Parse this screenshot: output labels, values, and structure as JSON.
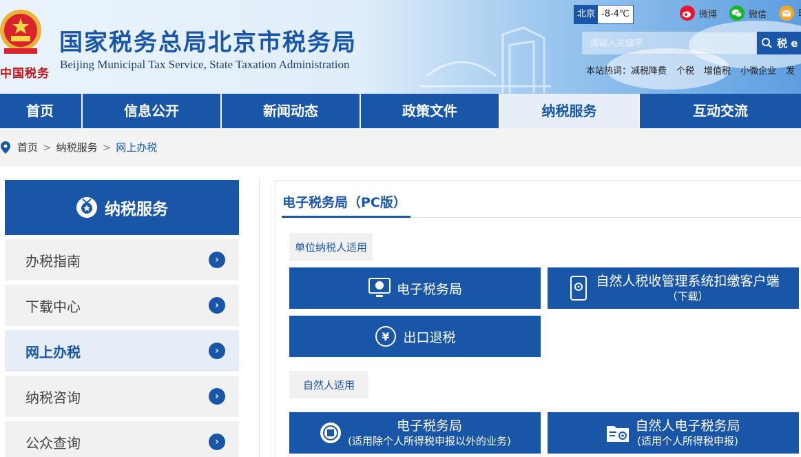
{
  "header": {
    "seal_text": "中国税务",
    "title": "国家税务总局北京市税务局",
    "subtitle": "Beijing Municipal Tax Service, State Taxation Administration",
    "weather_city": "北京",
    "weather_temp": "-8-4℃",
    "weibo_label": "微博",
    "wechat_label": "微信",
    "mail_label": "E",
    "search_placeholder": "请输入关键字",
    "search_button": "税 e",
    "hot_label": "本站热词：",
    "hot_words": [
      "减税降费",
      "个税",
      "增值税",
      "小微企业",
      "发"
    ]
  },
  "nav": {
    "items": [
      {
        "label": "首页"
      },
      {
        "label": "信息公开"
      },
      {
        "label": "新闻动态"
      },
      {
        "label": "政策文件"
      },
      {
        "label": "纳税服务"
      },
      {
        "label": "互动交流"
      }
    ]
  },
  "breadcrumb": {
    "home": "首页",
    "sep": ">",
    "level1": "纳税服务",
    "current": "网上办税"
  },
  "sidebar": {
    "title": "纳税服务",
    "items": [
      {
        "label": "办税指南",
        "arrow": "›"
      },
      {
        "label": "下载中心",
        "arrow": "›"
      },
      {
        "label": "网上办税",
        "arrow": "›"
      },
      {
        "label": "纳税咨询",
        "arrow": "›"
      },
      {
        "label": "公众查询",
        "arrow": "›"
      }
    ]
  },
  "main": {
    "title": "电子税务局（PC版）",
    "section1_tag": "单位纳税人适用",
    "section1_buttons": [
      {
        "label": "电子税务局"
      },
      {
        "label": "自然人税收管理系统扣缴客户端",
        "sub": "（下载）"
      },
      {
        "label": "出口退税"
      }
    ],
    "section2_tag": "自然人适用",
    "section2_buttons": [
      {
        "label": "电子税务局",
        "sub": "(适用除个人所得税申报以外的业务)"
      },
      {
        "label": "自然人电子税务局",
        "sub": "(适用个人所得税申报)"
      }
    ]
  },
  "colors": {
    "primary": "#1a56a8",
    "emblem_red": "#c0161c",
    "emblem_gold": "#e9b33b"
  }
}
